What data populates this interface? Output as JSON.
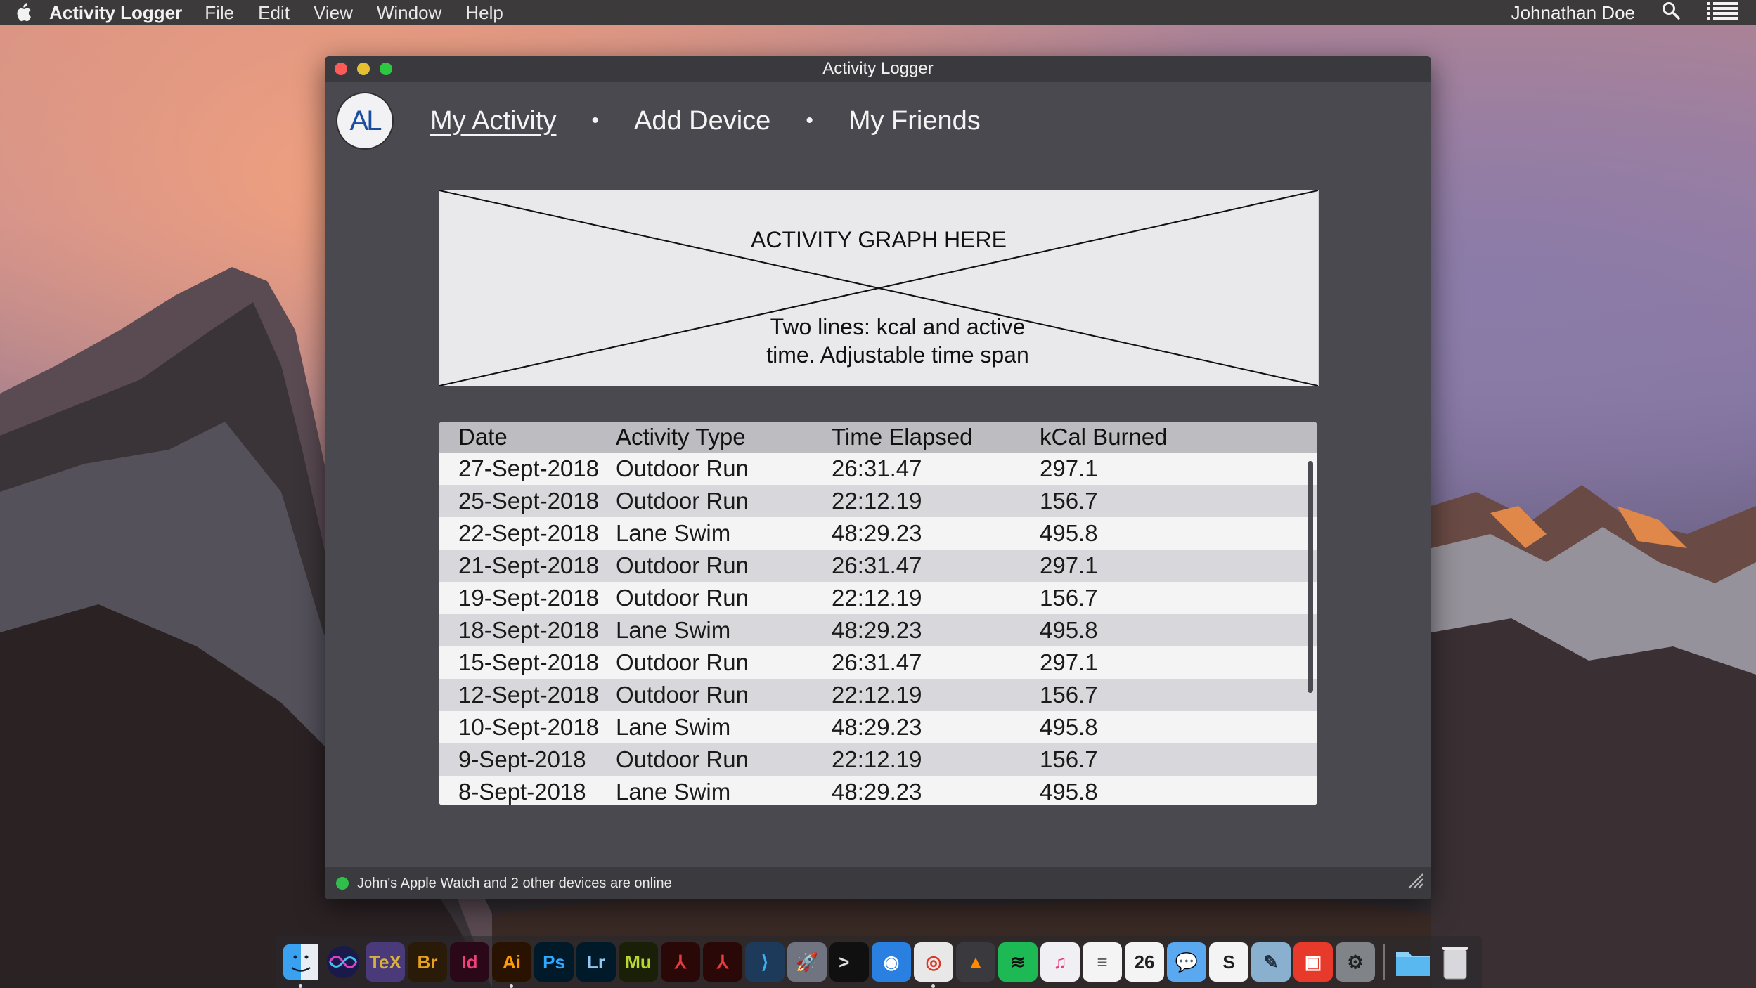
{
  "menubar": {
    "app_name": "Activity Logger",
    "menus": [
      "File",
      "Edit",
      "View",
      "Window",
      "Help"
    ],
    "user": "Johnathan Doe",
    "icons": [
      "apple-icon",
      "search-icon",
      "list-icon"
    ]
  },
  "window": {
    "title": "Activity Logger",
    "logo": "AL",
    "nav": {
      "my_activity": "My Activity",
      "add_device": "Add Device",
      "my_friends": "My Friends",
      "separator": "•"
    },
    "graph": {
      "title": "ACTIVITY GRAPH HERE",
      "description": "Two lines: kcal and active time. Adjustable time span"
    },
    "table": {
      "headers": [
        "Date",
        "Activity Type",
        "Time Elapsed",
        "kCal Burned"
      ],
      "rows": [
        [
          "27-Sept-2018",
          "Outdoor Run",
          "26:31.47",
          "297.1"
        ],
        [
          "25-Sept-2018",
          "Outdoor Run",
          "22:12.19",
          "156.7"
        ],
        [
          "22-Sept-2018",
          "Lane Swim",
          "48:29.23",
          "495.8"
        ],
        [
          "21-Sept-2018",
          "Outdoor Run",
          "26:31.47",
          "297.1"
        ],
        [
          "19-Sept-2018",
          "Outdoor Run",
          "22:12.19",
          "156.7"
        ],
        [
          "18-Sept-2018",
          "Lane Swim",
          "48:29.23",
          "495.8"
        ],
        [
          "15-Sept-2018",
          "Outdoor Run",
          "26:31.47",
          "297.1"
        ],
        [
          "12-Sept-2018",
          "Outdoor Run",
          "22:12.19",
          "156.7"
        ],
        [
          "10-Sept-2018",
          "Lane Swim",
          "48:29.23",
          "495.8"
        ],
        [
          "9-Sept-2018",
          "Outdoor Run",
          "22:12.19",
          "156.7"
        ],
        [
          "8-Sept-2018",
          "Lane Swim",
          "48:29.23",
          "495.8"
        ]
      ]
    },
    "status": "John's Apple Watch and 2 other devices are online"
  },
  "dock": {
    "apps": [
      {
        "name": "finder-icon",
        "label": "",
        "bg": "#3aa0f0",
        "fg": "#ffffff",
        "running": true
      },
      {
        "name": "siri-icon",
        "label": "",
        "bg": "#2a2a6a",
        "fg": "#ffffff",
        "running": false
      },
      {
        "name": "tex-icon",
        "label": "TeX",
        "bg": "#4a3a7a",
        "fg": "#d8b040",
        "running": false
      },
      {
        "name": "bridge-icon",
        "label": "Br",
        "bg": "#2a1a08",
        "fg": "#e8a020",
        "running": false
      },
      {
        "name": "indesign-icon",
        "label": "Id",
        "bg": "#2a0818",
        "fg": "#f0407a",
        "running": false
      },
      {
        "name": "illustrator-icon",
        "label": "Ai",
        "bg": "#2a1200",
        "fg": "#ff9a00",
        "running": true
      },
      {
        "name": "photoshop-icon",
        "label": "Ps",
        "bg": "#001a2a",
        "fg": "#31a8ff",
        "running": false
      },
      {
        "name": "lightroom-icon",
        "label": "Lr",
        "bg": "#001a2a",
        "fg": "#90c8f0",
        "running": false
      },
      {
        "name": "muse-icon",
        "label": "Mu",
        "bg": "#1a2008",
        "fg": "#b8d830",
        "running": false
      },
      {
        "name": "acrobat-icon",
        "label": "⅄",
        "bg": "#2a0808",
        "fg": "#e83a3a",
        "running": false
      },
      {
        "name": "acrobat-reader-icon",
        "label": "⅄",
        "bg": "#2a0808",
        "fg": "#e83a3a",
        "running": false
      },
      {
        "name": "vscode-icon",
        "label": "⟩",
        "bg": "#1e3a5a",
        "fg": "#3ab0f0",
        "running": false
      },
      {
        "name": "launchpad-icon",
        "label": "🚀",
        "bg": "#707480",
        "fg": "#ffffff",
        "running": false
      },
      {
        "name": "terminal-icon",
        "label": ">_",
        "bg": "#101010",
        "fg": "#e0e0e0",
        "running": false
      },
      {
        "name": "safari-icon",
        "label": "◉",
        "bg": "#2a80e0",
        "fg": "#ffffff",
        "running": false
      },
      {
        "name": "chrome-icon",
        "label": "◎",
        "bg": "#e8e8e8",
        "fg": "#d83a2a",
        "running": true
      },
      {
        "name": "vlc-icon",
        "label": "▲",
        "bg": "#3a3a3e",
        "fg": "#ff8a00",
        "running": false
      },
      {
        "name": "spotify-icon",
        "label": "≋",
        "bg": "#1db954",
        "fg": "#101010",
        "running": false
      },
      {
        "name": "itunes-icon",
        "label": "♫",
        "bg": "#f0f0f4",
        "fg": "#e8407a",
        "running": false
      },
      {
        "name": "textedit-icon",
        "label": "≡",
        "bg": "#f4f4f4",
        "fg": "#606060",
        "running": false
      },
      {
        "name": "calendar-icon",
        "label": "26",
        "bg": "#f4f4f4",
        "fg": "#202020",
        "running": false
      },
      {
        "name": "messages-icon",
        "label": "💬",
        "bg": "#5aa8f0",
        "fg": "#ffffff",
        "running": false
      },
      {
        "name": "slack-icon",
        "label": "S",
        "bg": "#f4f4f4",
        "fg": "#202020",
        "running": false
      },
      {
        "name": "preview-icon",
        "label": "✎",
        "bg": "#8ab0d0",
        "fg": "#203040",
        "running": false
      },
      {
        "name": "screenshare-icon",
        "label": "▣",
        "bg": "#e83a2a",
        "fg": "#ffffff",
        "running": false
      },
      {
        "name": "system-preferences-icon",
        "label": "⚙",
        "bg": "#808488",
        "fg": "#202020",
        "running": false
      }
    ],
    "trailing": [
      {
        "name": "folder-icon",
        "label": "",
        "bg": "#5ab8f0",
        "fg": "#ffffff"
      },
      {
        "name": "trash-icon",
        "label": "",
        "bg": "rgba(0,0,0,0)",
        "fg": "#e0e0e0"
      }
    ]
  },
  "colors": {
    "window_bg": "#4a494f",
    "table_header_bg": "#bdbdc1",
    "status_online": "#2fbf4a",
    "logo_text": "#1a4fa0"
  }
}
